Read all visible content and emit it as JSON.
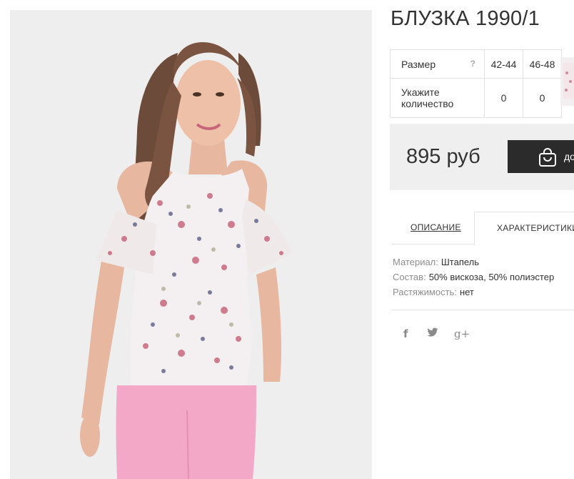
{
  "product": {
    "title": "БЛУЗКА 1990/1",
    "image_alt": "Model wearing floral cold-shoulder blouse with pink trousers"
  },
  "sizes": {
    "header_label": "Размер",
    "help": "?",
    "columns": [
      "42-44",
      "46-48"
    ],
    "quantity_label": "Укажите количество",
    "quantities": [
      "0",
      "0"
    ]
  },
  "price": {
    "value": "895 руб",
    "cart_button_label": "до"
  },
  "tabs": {
    "description": "ОПИСАНИЕ",
    "characteristics": "ХАРАКТЕРИСТИКИ"
  },
  "specs": [
    {
      "key": "Материал:",
      "value": "Штапель"
    },
    {
      "key": "Состав:",
      "value": "50% вискоза, 50% полиэстер"
    },
    {
      "key": "Растяжимость:",
      "value": "нет"
    }
  ],
  "social": {
    "facebook": "f",
    "twitter": "t",
    "googleplus": "g+"
  },
  "colors": {
    "page_bg": "#ffffff",
    "photo_bg": "#efeeef",
    "price_bg": "#efefef",
    "button_bg": "#2b2b2b",
    "trousers": "#f2a8c6"
  }
}
